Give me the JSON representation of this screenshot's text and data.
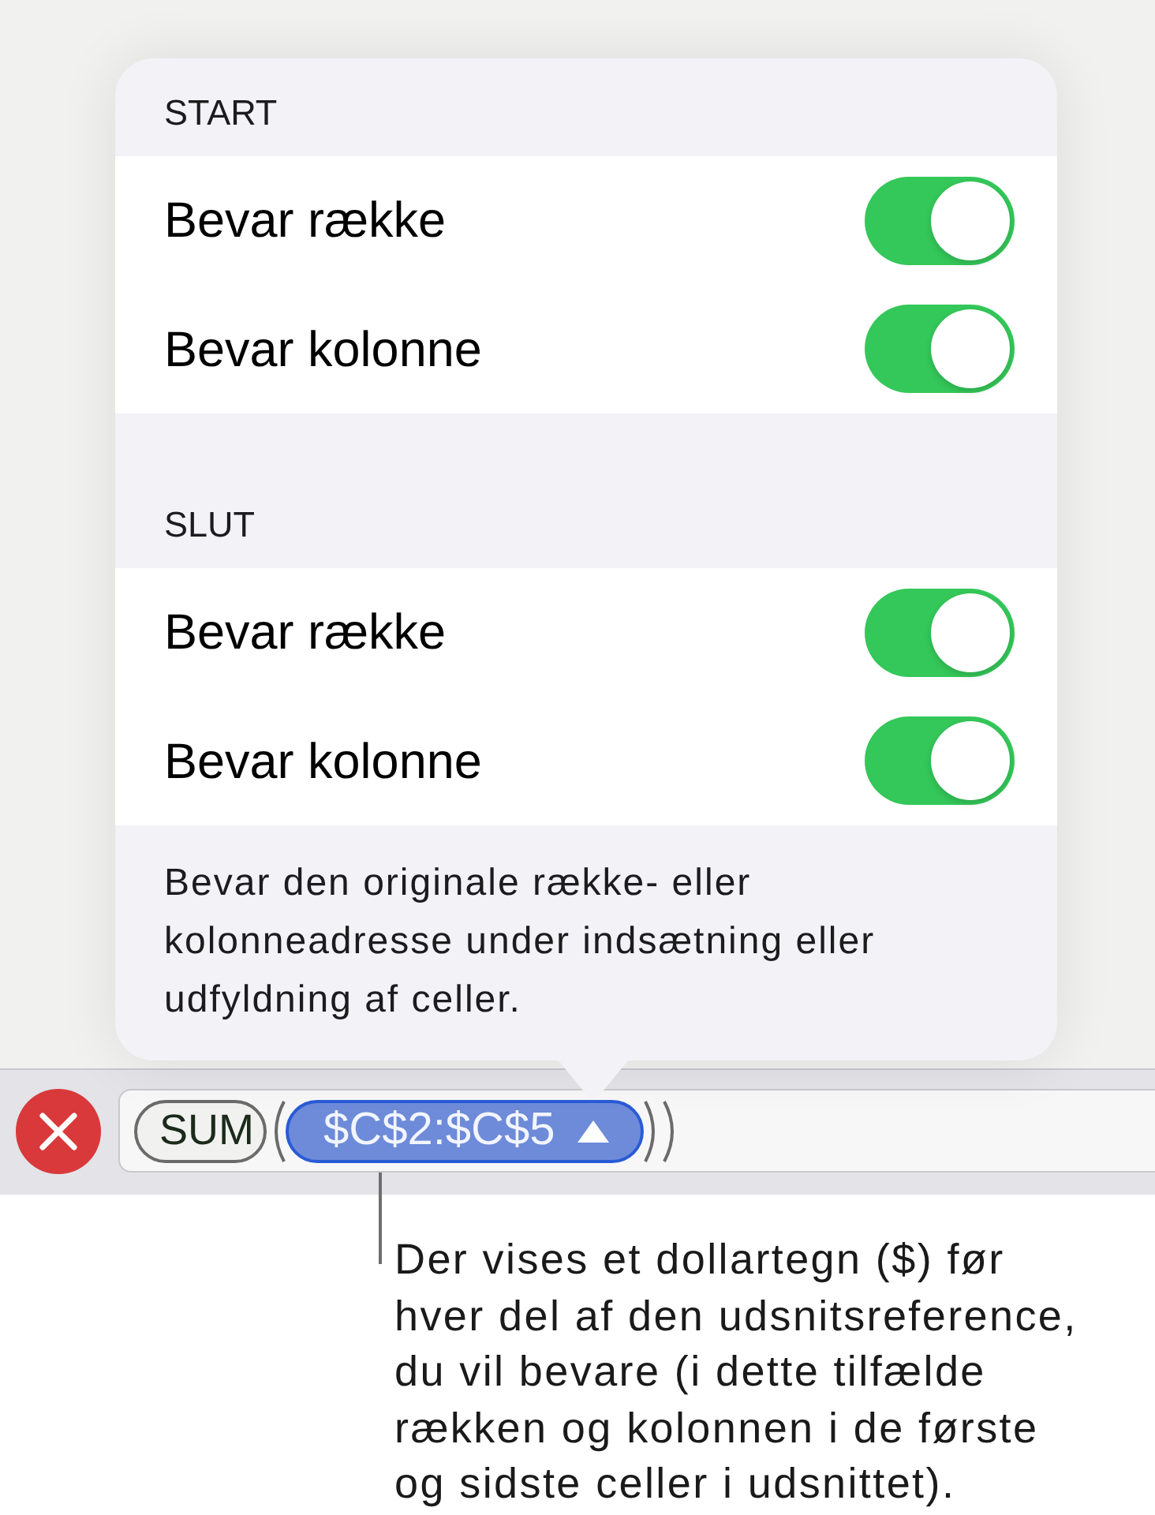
{
  "popover": {
    "sections": [
      {
        "header": "START",
        "rows": [
          {
            "label": "Bevar række",
            "on": true
          },
          {
            "label": "Bevar kolonne",
            "on": true
          }
        ]
      },
      {
        "header": "SLUT",
        "rows": [
          {
            "label": "Bevar række",
            "on": true
          },
          {
            "label": "Bevar kolonne",
            "on": true
          }
        ]
      }
    ],
    "footer": "Bevar den originale række- eller kolonneadresse under indsætning eller udfyldning af celler."
  },
  "formula_bar": {
    "tokens": [
      {
        "kind": "function",
        "text": "SUM",
        "selected": false
      },
      {
        "kind": "reference",
        "text": "$C$2:$C$5",
        "selected": true
      }
    ]
  },
  "callout": "Der vises et dollartegn ($) før hver del af den udsnitsreference, du vil bevare (i dette tilfælde rækken og kolonnen i de første og sidste celler i udsnittet)."
}
